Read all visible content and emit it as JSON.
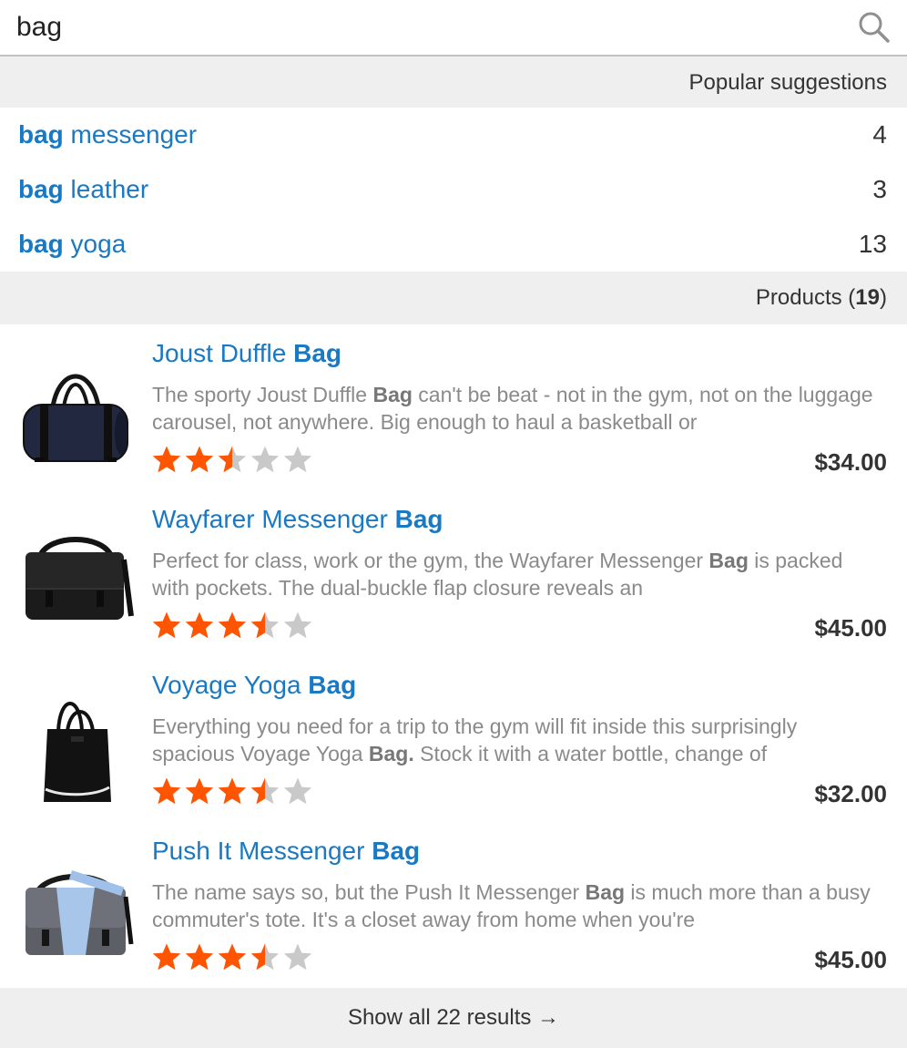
{
  "search": {
    "value": "bag",
    "placeholder": ""
  },
  "suggestions": {
    "header": "Popular suggestions",
    "items": [
      {
        "highlight": "bag",
        "rest": " messenger",
        "count": "4"
      },
      {
        "highlight": "bag",
        "rest": " leather",
        "count": "3"
      },
      {
        "highlight": "bag",
        "rest": " yoga",
        "count": "13"
      }
    ]
  },
  "products": {
    "header_label": "Products (",
    "count": "19",
    "header_close": ")",
    "items": [
      {
        "title_start": "Joust Duffle ",
        "title_highlight": "Bag",
        "desc_1": "The sporty Joust Duffle ",
        "desc_highlight": "Bag",
        "desc_2": " can't be beat - not in the gym, not on the luggage carousel, not anywhere. Big enough to haul a basketball or",
        "rating": 2.5,
        "price": "$34.00",
        "image_icon": "duffle-bag-icon"
      },
      {
        "title_start": "Wayfarer Messenger ",
        "title_highlight": "Bag",
        "desc_1": "Perfect for class, work or the gym, the Wayfarer Messenger ",
        "desc_highlight": "Bag",
        "desc_2": " is packed with pockets. The dual-buckle flap closure reveals an",
        "rating": 3.5,
        "price": "$45.00",
        "image_icon": "messenger-bag-icon"
      },
      {
        "title_start": "Voyage Yoga ",
        "title_highlight": "Bag",
        "desc_1": "Everything you need for a trip to the gym will fit inside this surprisingly spacious Voyage Yoga ",
        "desc_highlight": "Bag.",
        "desc_2": " Stock it with a water bottle, change of",
        "rating": 3.5,
        "price": "$32.00",
        "image_icon": "tote-bag-icon"
      },
      {
        "title_start": "Push It Messenger ",
        "title_highlight": "Bag",
        "desc_1": "The name says so, but the Push It Messenger ",
        "desc_highlight": "Bag",
        "desc_2": " is much more than a busy commuter's tote. It's a closet away from home when you're",
        "rating": 3.5,
        "price": "$45.00",
        "image_icon": "messenger-bag-blue-icon"
      }
    ]
  },
  "footer": {
    "label": "Show all 22 results →"
  },
  "colors": {
    "link": "#1979c3",
    "star_filled": "#ff5501",
    "star_empty": "#c9c9c9",
    "header_bg": "#efefef"
  }
}
